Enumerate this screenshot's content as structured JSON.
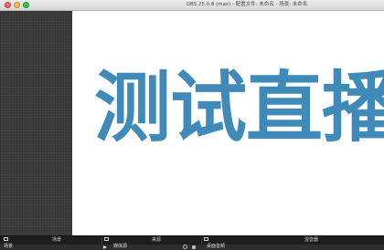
{
  "window": {
    "title": "OBS 25.0.8 (mac) - 配置文件: 未命名 - 场景: 未命名"
  },
  "preview": {
    "text": "测试直播",
    "text_color": "#3f8ab8"
  },
  "docks": {
    "scenes_label": "场景",
    "sources_label": "来源",
    "mixer_label": "混音器"
  },
  "dock_content": {
    "scene_item": "场景",
    "source_item": "媒体源",
    "mixer_item": "桌面音频"
  }
}
